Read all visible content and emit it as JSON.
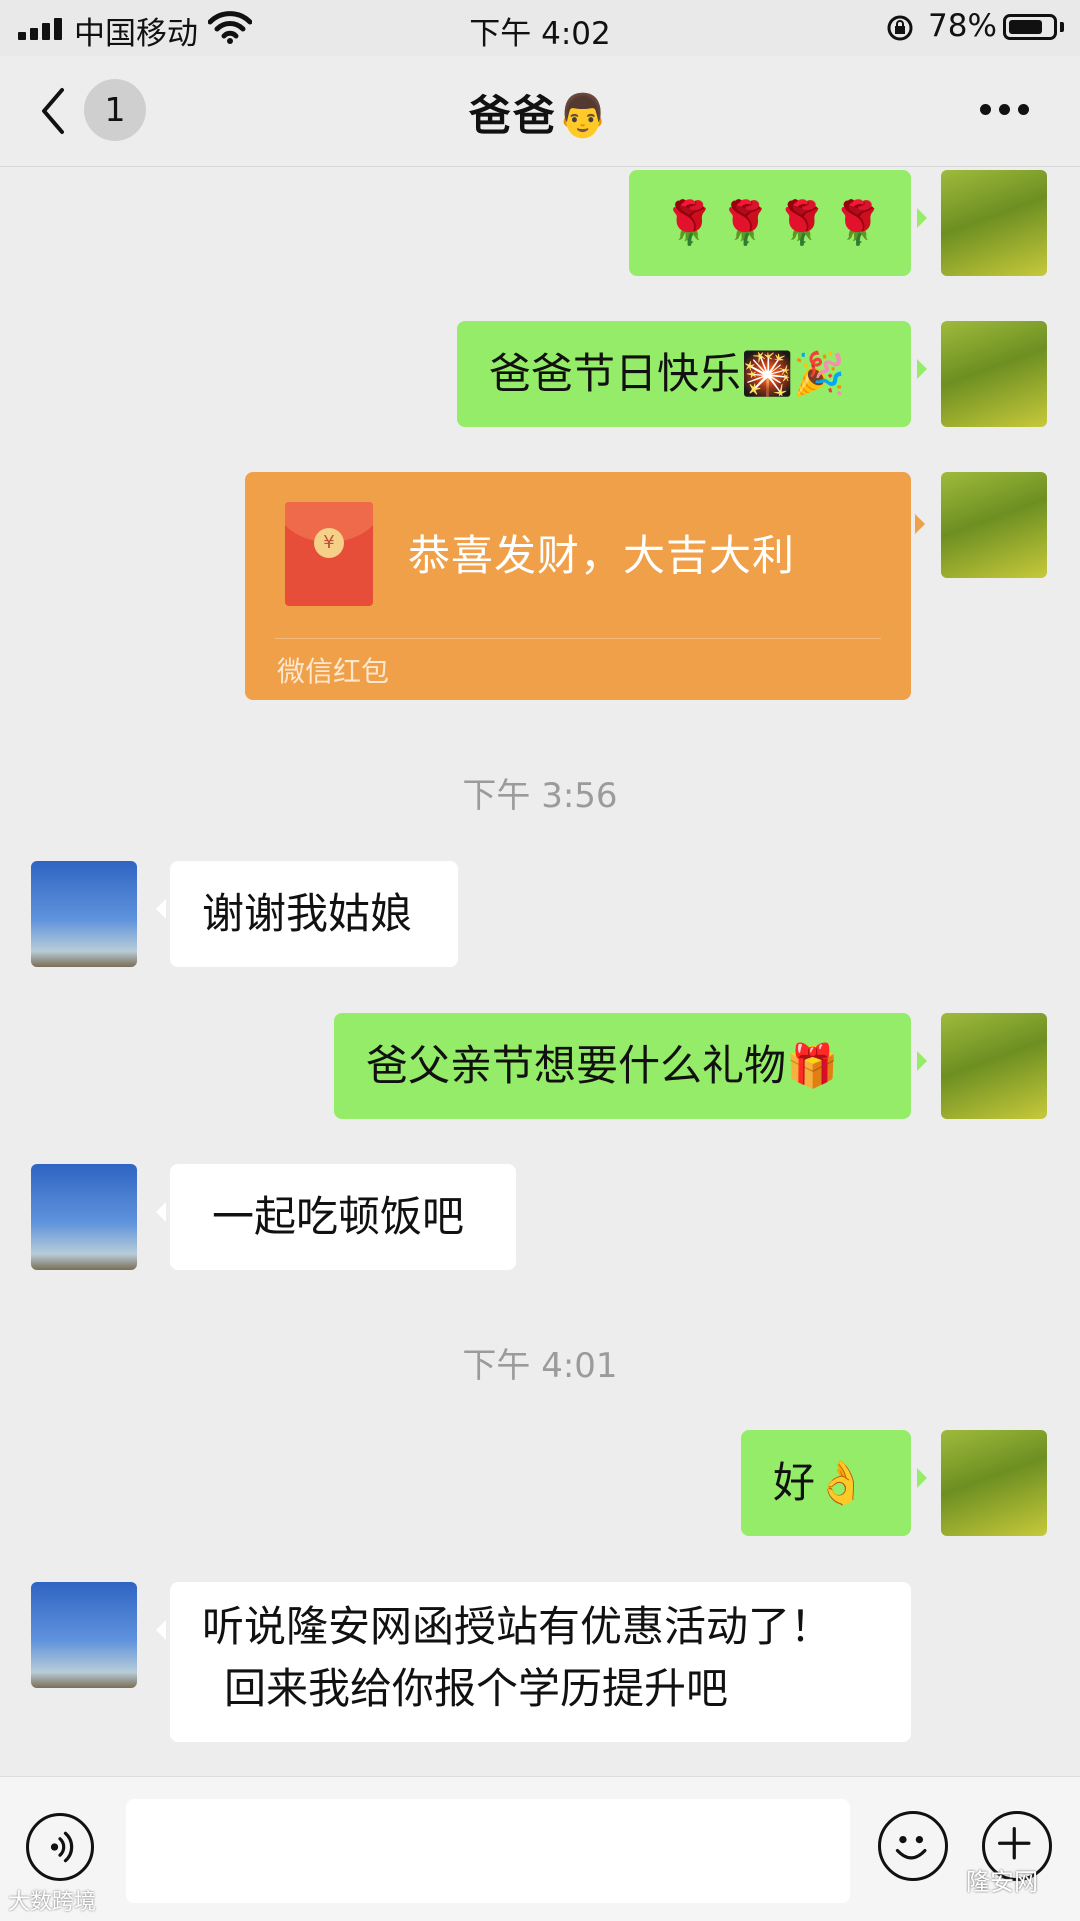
{
  "status_bar": {
    "carrier": "中国移动",
    "time": "下午 4:02",
    "battery_percent": "78%",
    "battery_level": 0.78
  },
  "nav": {
    "unread_count": "1",
    "title": "爸爸👨"
  },
  "messages": [
    {
      "side": "me",
      "type": "text",
      "text": "🌹🌹🌹🌹"
    },
    {
      "side": "me",
      "type": "text",
      "text": "爸爸节日快乐🎇🎉"
    },
    {
      "side": "me",
      "type": "red_packet",
      "greeting": "恭喜发财，大吉大利",
      "label": "微信红包",
      "icon": "red-envelope-icon"
    },
    {
      "type": "timestamp",
      "text": "下午 3:56"
    },
    {
      "side": "dad",
      "type": "text",
      "text": "谢谢我姑娘"
    },
    {
      "side": "me",
      "type": "text",
      "text": "爸父亲节想要什么礼物🎁"
    },
    {
      "side": "dad",
      "type": "text",
      "text": "一起吃顿饭吧"
    },
    {
      "type": "timestamp",
      "text": "下午 4:01"
    },
    {
      "side": "me",
      "type": "text",
      "text": "好👌"
    },
    {
      "side": "dad",
      "type": "text",
      "lines": [
        "听说隆安网函授站有优惠活动了！",
        "回来我给你报个学历提升吧"
      ]
    }
  ],
  "input_bar": {
    "voice_icon": "voice-icon",
    "emoji_icon": "emoji-icon",
    "plus_icon": "plus-icon",
    "input_value": ""
  },
  "watermarks": {
    "left": "大数跨境",
    "right": "隆安网"
  },
  "colors": {
    "background": "#ededed",
    "my_bubble": "#95ec69",
    "their_bubble": "#ffffff",
    "red_packet": "#f0a049",
    "timestamp": "#9b9b9b"
  }
}
